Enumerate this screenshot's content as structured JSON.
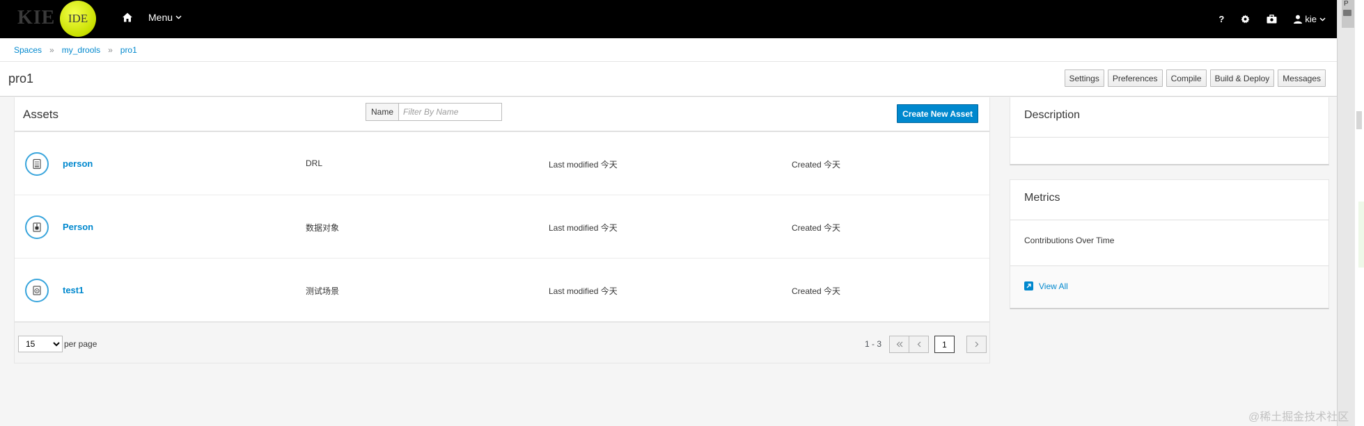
{
  "navbar": {
    "logo_text": "KIE",
    "logo_badge": "IDE",
    "menu_label": "Menu",
    "user_label": "kie",
    "help_label": "?"
  },
  "breadcrumb": [
    "Spaces",
    "my_drools",
    "pro1"
  ],
  "breadcrumb_sep": "»",
  "page_title": "pro1",
  "toolbar": [
    "Settings",
    "Preferences",
    "Compile",
    "Build & Deploy",
    "Messages"
  ],
  "assets": {
    "title": "Assets",
    "filter_label": "Name",
    "filter_placeholder": "Filter By Name",
    "create_label": "Create New Asset",
    "items": [
      {
        "name": "person",
        "type": "DRL",
        "last_modified": "Last modified 今天",
        "created": "Created 今天",
        "icon": "drl-file-icon"
      },
      {
        "name": "Person",
        "type": "数据对象",
        "last_modified": "Last modified 今天",
        "created": "Created 今天",
        "icon": "data-object-icon"
      },
      {
        "name": "test1",
        "type": "测试场景",
        "last_modified": "Last modified 今天",
        "created": "Created 今天",
        "icon": "test-scenario-icon"
      }
    ]
  },
  "pager": {
    "per_page_value": "15",
    "per_page_label": "per page",
    "range": "1 - 3",
    "page": "1"
  },
  "description": {
    "title": "Description"
  },
  "metrics": {
    "title": "Metrics",
    "subtitle": "Contributions Over Time",
    "view_all": "View All"
  },
  "scrollbar_label": "P",
  "watermark": "@稀土掘金技术社区",
  "colors": {
    "accent": "#0088ce",
    "navbar": "#000000",
    "icon_ring": "#39a5dc"
  }
}
